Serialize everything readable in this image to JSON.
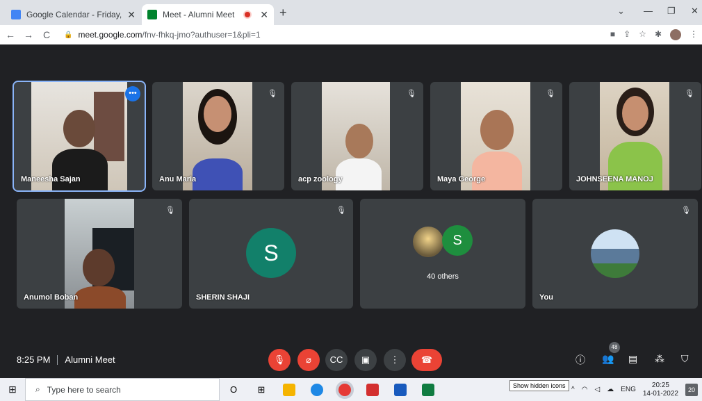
{
  "browser": {
    "tabs": [
      {
        "title": "Google Calendar - Friday, Januar",
        "close": "✕",
        "favicon_color": "#4285f4"
      },
      {
        "title": "Meet - Alumni Meet",
        "close": "✕",
        "favicon_color": "#00832d"
      }
    ],
    "new_tab": "+",
    "window_controls": [
      "⌄",
      "—",
      "❐",
      "✕"
    ],
    "nav": [
      "←",
      "→",
      "C"
    ],
    "url_host": "meet.google.com",
    "url_path": "/fnv-fhkq-jmo?authuser=1&pli=1",
    "addr_icons": [
      "■",
      "⇪",
      "☆",
      "✱"
    ]
  },
  "meet": {
    "more_options": "•••",
    "mute_glyph": "🎙",
    "participants": [
      {
        "name": "Maneesha Sajan"
      },
      {
        "name": "Anu Maria"
      },
      {
        "name": "acp zoology"
      },
      {
        "name": "Maya George"
      },
      {
        "name": "JOHNSEENA MANOJ"
      },
      {
        "name": "Anumol Boban"
      },
      {
        "name": "SHERIN SHAJI",
        "avatar_letter": "S"
      },
      {
        "name": "40 others",
        "avatar_letter": "S"
      },
      {
        "name": "You"
      }
    ],
    "meeting_time": "8:25 PM",
    "meeting_name": "Alumni Meet",
    "controls": [
      "🎙",
      "⌀",
      "CC",
      "▣",
      "⋮",
      "☎"
    ],
    "right_controls": [
      "ⓘ",
      "👥",
      "▤",
      "⁂",
      "⛉"
    ],
    "participant_count": "48"
  },
  "taskbar": {
    "start": "⊞",
    "search_placeholder": "Type here to search",
    "search_icon": "⌕",
    "task_icons": [
      "O",
      "⊞"
    ],
    "app_colors": [
      "#f5b400",
      "#1e88e5",
      "#e53935",
      "#d32f2f",
      "#185abd",
      "#107c41"
    ],
    "tray": [
      "ENG"
    ],
    "time": "20:25",
    "date": "14-01-2022",
    "notification_count": "20",
    "tooltip": "Show hidden icons"
  }
}
